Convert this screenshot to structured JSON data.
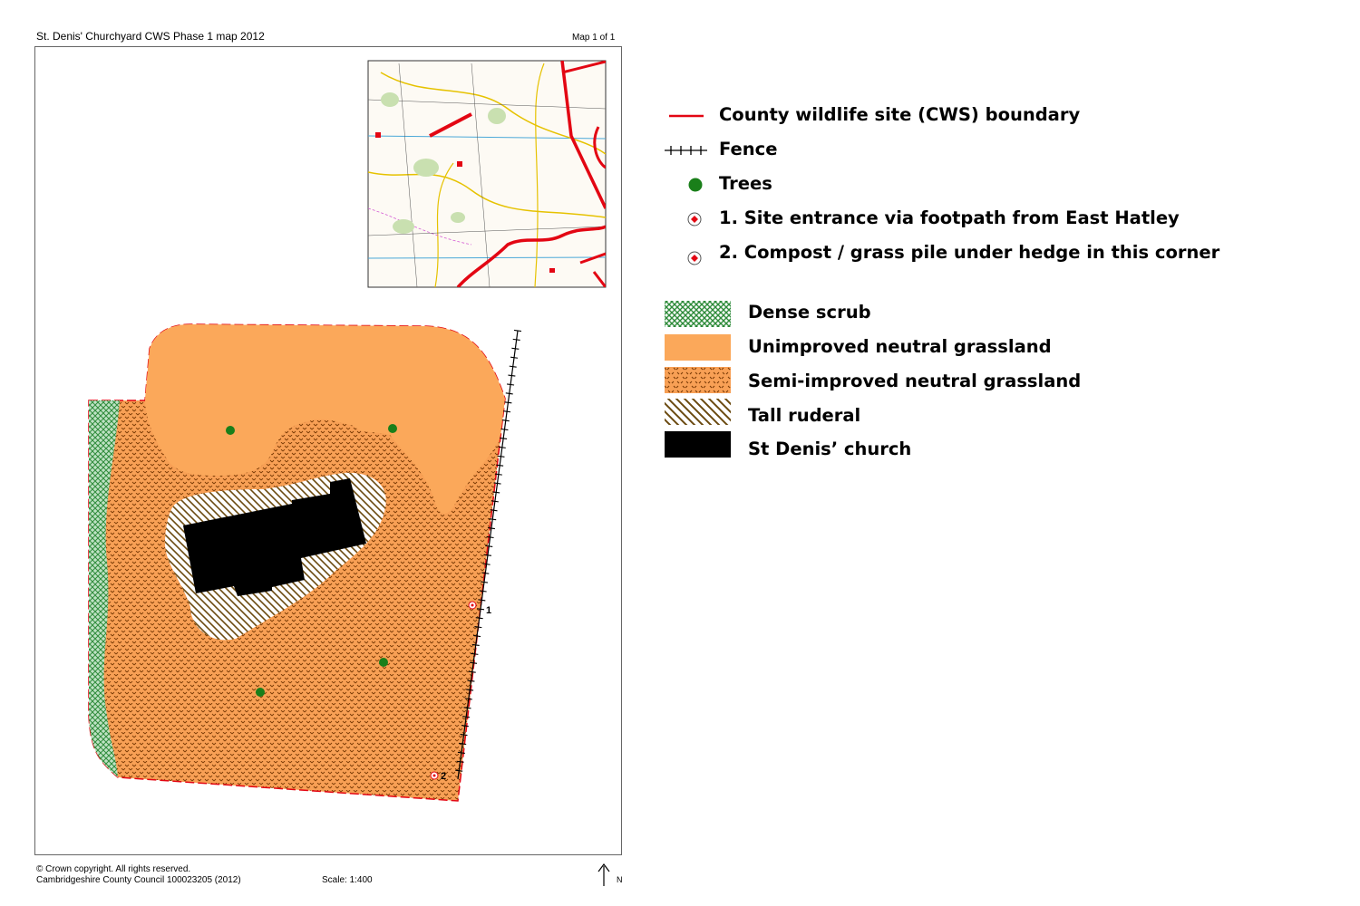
{
  "header": {
    "title": "St. Denis' Churchyard CWS Phase 1 map 2012",
    "map_number": "Map 1 of 1"
  },
  "footer": {
    "copyright": "© Crown copyright.  All rights reserved.",
    "licence": "Cambridgeshire County Council 100023205 (2012)",
    "scale": "Scale: 1:400",
    "north": "N"
  },
  "map": {
    "point_labels": [
      "1",
      "2"
    ]
  },
  "legend": {
    "symbols": [
      {
        "label": "County wildlife site (CWS) boundary",
        "icon": "red-line-icon",
        "color": "#e30613"
      },
      {
        "label": "Fence",
        "icon": "fence-line-icon",
        "color": "#000000"
      },
      {
        "label": "Trees",
        "icon": "tree-dot-icon",
        "color": "#1a7f1a"
      },
      {
        "label": "1.  Site entrance via footpath from East Hatley",
        "icon": "target-point-icon",
        "color": "#e30613"
      },
      {
        "label": "2.  Compost / grass pile under hedge in this corner",
        "icon": "target-point-icon",
        "color": "#e30613"
      }
    ],
    "habitats": [
      {
        "label": "Dense scrub",
        "color": "#2e8b3a"
      },
      {
        "label": "Unimproved neutral grassland",
        "color": "#fba85a"
      },
      {
        "label": "Semi-improved neutral grassland",
        "color": "#f8a055"
      },
      {
        "label": "Tall ruderal",
        "color": "#7a5a10"
      },
      {
        "label": "St Denis’ church",
        "color": "#000000"
      }
    ]
  }
}
